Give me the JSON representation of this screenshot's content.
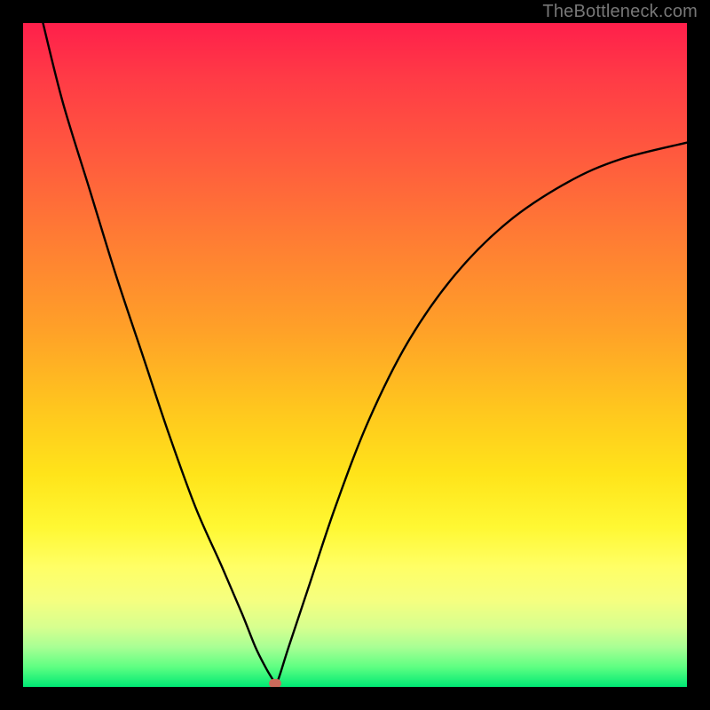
{
  "watermark": "TheBottleneck.com",
  "chart_data": {
    "type": "line",
    "title": "",
    "xlabel": "",
    "ylabel": "",
    "xlim": [
      0,
      100
    ],
    "ylim": [
      0,
      100
    ],
    "grid": false,
    "legend": false,
    "series": [
      {
        "name": "curve",
        "x": [
          3,
          6,
          10,
          14,
          18,
          22,
          26,
          30,
          33,
          35,
          36.5,
          37.5,
          38,
          38.5,
          40,
          43,
          47,
          52,
          58,
          65,
          73,
          82,
          90,
          100
        ],
        "y": [
          100,
          88,
          75,
          62,
          50,
          38,
          27,
          18,
          11,
          6,
          3,
          1.3,
          0.6,
          1.3,
          6,
          15,
          27,
          40,
          52,
          62,
          70,
          76,
          79.5,
          82
        ]
      }
    ],
    "marker": {
      "x": 38,
      "y": 0.6,
      "color": "#c96a5a"
    },
    "background_gradient": {
      "top": "#ff1f4b",
      "mid": "#ffe41a",
      "bottom": "#00e874"
    }
  }
}
